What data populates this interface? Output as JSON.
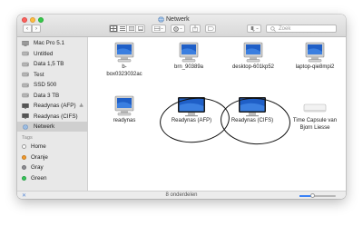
{
  "window": {
    "title": "Netwerk"
  },
  "toolbar": {
    "back": "‹",
    "forward": "›",
    "search_placeholder": "Zoek",
    "view_modes": [
      "icon-view",
      "list-view",
      "column-view",
      "gallery-view"
    ],
    "group_icon": "grid-group-icon",
    "action_icon": "gear-icon",
    "share_icon": "share-icon",
    "tag_icon": "tag-icon",
    "dropbox_icon": "dropbox-icon"
  },
  "sidebar": {
    "items": [
      {
        "label": "Mac Pro 5.1",
        "icon": "computer-icon"
      },
      {
        "label": "Untitled",
        "icon": "drive-icon"
      },
      {
        "label": "Data 1,5 TB",
        "icon": "drive-icon"
      },
      {
        "label": "Test",
        "icon": "drive-icon"
      },
      {
        "label": "SSD 500",
        "icon": "drive-icon"
      },
      {
        "label": "Data 3 TB",
        "icon": "drive-icon"
      },
      {
        "label": "Readynas (AFP)",
        "icon": "display-icon",
        "eject": "≜"
      },
      {
        "label": "Readynas (CIFS)",
        "icon": "display-icon"
      },
      {
        "label": "Netwerk",
        "icon": "globe-icon",
        "selected": true
      }
    ],
    "tags_header": "Tags",
    "tags": [
      {
        "label": "Home",
        "color": "#ffffff"
      },
      {
        "label": "Oranje",
        "color": "#f49a2b"
      },
      {
        "label": "Gray",
        "color": "#8e8e93"
      },
      {
        "label": "Green",
        "color": "#34c759"
      }
    ]
  },
  "main": {
    "items": [
      {
        "label": "b-box0323032ac",
        "icon": "crt-monitor-icon"
      },
      {
        "label": "brn_90389a",
        "icon": "crt-monitor-icon"
      },
      {
        "label": "desktop-601kp52",
        "icon": "crt-monitor-icon"
      },
      {
        "label": "laptop-qie8mpi2",
        "icon": "crt-monitor-icon"
      },
      {
        "label": "readynas",
        "icon": "crt-monitor-icon"
      },
      {
        "label": "Readynas (AFP)",
        "icon": "flat-display-icon"
      },
      {
        "label": "Readynas (CIFS)",
        "icon": "flat-display-icon"
      },
      {
        "label": "Time Capsule van Bjorn Liesse",
        "icon": "time-capsule-icon"
      }
    ],
    "item_label_lines": {
      "b-box0323032ac": [
        "b-",
        "box0323032ac"
      ],
      "Time Capsule van Bjorn Liesse": [
        "Time Capsule van",
        "Bjorn Liesse"
      ]
    }
  },
  "statusbar": {
    "text": "8 onderdelen",
    "zoom_level": 0.35
  },
  "colors": {
    "screen_blue": "#1f5fc7",
    "annotation": "#111111",
    "selection": "#cfcfcf"
  }
}
